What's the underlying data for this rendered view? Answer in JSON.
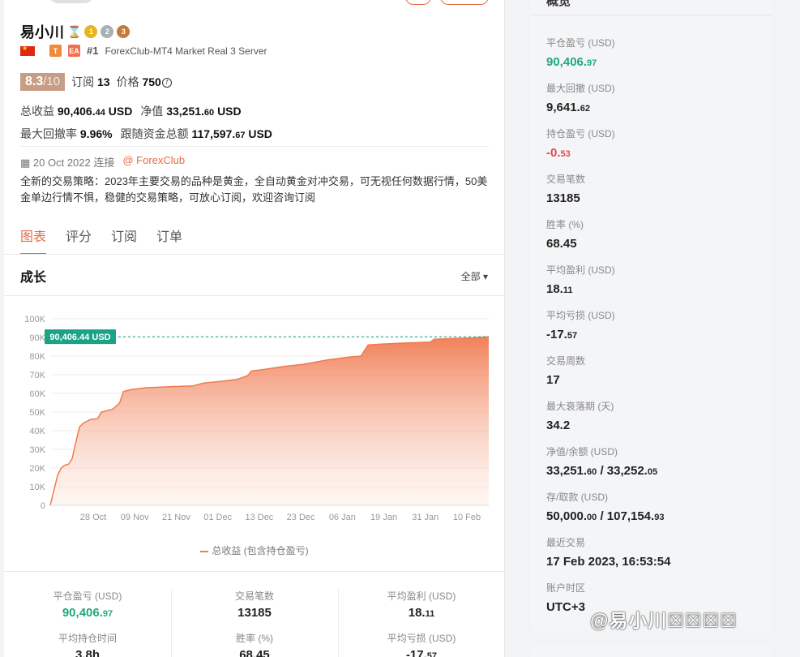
{
  "profile": {
    "name": "易小川",
    "rank": "#1",
    "server": "ForexClub-MT4 Market Real 3 Server",
    "tag_t": "T",
    "tag_ea": "EA",
    "score": "8.3",
    "score_max": "/10",
    "subs_label": "订阅",
    "subs_value": "13",
    "price_label": "价格",
    "price_value": "750",
    "total_profit_label": "总收益",
    "total_profit_int": "90,406.",
    "total_profit_dec": "44",
    "total_profit_unit": "USD",
    "equity_label": "净值",
    "equity_int": "33,251.",
    "equity_dec": "60",
    "equity_unit": "USD",
    "max_dd_label": "最大回撤率",
    "max_dd_value": "9.96%",
    "follow_label": "跟随资金总额",
    "follow_int": "117,597.",
    "follow_dec": "67",
    "follow_unit": "USD",
    "date": "20 Oct 2022 连接",
    "broker": "@ ForexClub",
    "description": "全新的交易策略：2023年主要交易的品种是黄金，全自动黄金对冲交易，可无视任何数据行情，50美金单边行情不惧，稳健的交易策略，可放心订阅，欢迎咨询订阅"
  },
  "tabs": [
    {
      "label": "图表",
      "active": true
    },
    {
      "label": "评分"
    },
    {
      "label": "订阅"
    },
    {
      "label": "订单"
    }
  ],
  "chart_section": {
    "title": "成长",
    "range": "全部 ▾",
    "legend": "总收益 (包含持仓盈亏)"
  },
  "chart_data": {
    "type": "area",
    "title": "",
    "xlabel": "",
    "ylabel": "",
    "ylim": [
      0,
      100000
    ],
    "y_ticks": [
      0,
      10000,
      20000,
      30000,
      40000,
      50000,
      60000,
      70000,
      80000,
      90000,
      100000
    ],
    "y_tick_labels": [
      "0",
      "10K",
      "20K",
      "30K",
      "40K",
      "50K",
      "60K",
      "70K",
      "80K",
      "90K",
      "100K"
    ],
    "x_ticks": [
      "28 Oct",
      "09 Nov",
      "21 Nov",
      "01 Dec",
      "13 Dec",
      "23 Dec",
      "06 Jan",
      "19 Jan",
      "31 Jan",
      "10 Feb"
    ],
    "x_range": [
      "2022-10-20",
      "2023-02-17"
    ],
    "current_label": "90,406.44 USD",
    "current_value": 90406.44,
    "series": [
      {
        "name": "总收益 (包含持仓盈亏)",
        "color": "#f07a50",
        "points": [
          [
            "2022-10-20",
            0
          ],
          [
            "2022-10-21",
            8000
          ],
          [
            "2022-10-22",
            16000
          ],
          [
            "2022-10-23",
            20000
          ],
          [
            "2022-10-24",
            21500
          ],
          [
            "2022-10-25",
            22000
          ],
          [
            "2022-10-26",
            25000
          ],
          [
            "2022-10-27",
            34000
          ],
          [
            "2022-10-28",
            42000
          ],
          [
            "2022-10-29",
            44000
          ],
          [
            "2022-10-31",
            46000
          ],
          [
            "2022-11-02",
            46500
          ],
          [
            "2022-11-03",
            50000
          ],
          [
            "2022-11-04",
            50500
          ],
          [
            "2022-11-06",
            51500
          ],
          [
            "2022-11-07",
            53000
          ],
          [
            "2022-11-08",
            55000
          ],
          [
            "2022-11-09",
            61000
          ],
          [
            "2022-11-11",
            62000
          ],
          [
            "2022-11-15",
            63000
          ],
          [
            "2022-11-21",
            63500
          ],
          [
            "2022-11-28",
            64000
          ],
          [
            "2022-12-01",
            65500
          ],
          [
            "2022-12-06",
            66500
          ],
          [
            "2022-12-10",
            67500
          ],
          [
            "2022-12-13",
            69500
          ],
          [
            "2022-12-14",
            72000
          ],
          [
            "2022-12-18",
            73000
          ],
          [
            "2022-12-23",
            74500
          ],
          [
            "2022-12-28",
            75500
          ],
          [
            "2023-01-04",
            78000
          ],
          [
            "2023-01-10",
            79500
          ],
          [
            "2023-01-13",
            80000
          ],
          [
            "2023-01-15",
            86000
          ],
          [
            "2023-01-19",
            86500
          ],
          [
            "2023-01-25",
            87000
          ],
          [
            "2023-02-01",
            87500
          ],
          [
            "2023-02-02",
            89000
          ],
          [
            "2023-02-08",
            89500
          ],
          [
            "2023-02-13",
            89800
          ],
          [
            "2023-02-17",
            90406.44
          ]
        ]
      }
    ]
  },
  "bottom_stats": [
    {
      "label": "平仓盈亏 (USD)",
      "int": "90,406.",
      "dec": "97",
      "style": "green"
    },
    {
      "label": "交易笔数",
      "int": "13185",
      "dec": ""
    },
    {
      "label": "平均盈利 (USD)",
      "int": "18.",
      "dec": "11"
    },
    {
      "label": "平均持仓时间",
      "int": "3.8h",
      "dec": ""
    },
    {
      "label": "胜率 (%)",
      "int": "68.45",
      "dec": ""
    },
    {
      "label": "平均亏损 (USD)",
      "int": "-17.",
      "dec": "57"
    }
  ],
  "overview": {
    "title": "概览",
    "items": [
      {
        "label": "平仓盈亏 (USD)",
        "int": "90,406.",
        "dec": "97",
        "style": "green"
      },
      {
        "label": "最大回撤 (USD)",
        "int": "9,641.",
        "dec": "62"
      },
      {
        "label": "持仓盈亏 (USD)",
        "int": "-0.",
        "dec": "53",
        "style": "red"
      },
      {
        "label": "交易笔数",
        "int": "13185",
        "dec": ""
      },
      {
        "label": "胜率 (%)",
        "int": "68.45",
        "dec": ""
      },
      {
        "label": "平均盈利 (USD)",
        "int": "18.",
        "dec": "11"
      },
      {
        "label": "平均亏损 (USD)",
        "int": "-17.",
        "dec": "57"
      },
      {
        "label": "交易周数",
        "int": "17",
        "dec": ""
      },
      {
        "label": "最大衰落期 (天)",
        "int": "34.2",
        "dec": ""
      },
      {
        "label": "净值/余额 (USD)",
        "int": "33,251.",
        "dec": "60",
        "int2": " / 33,252.",
        "dec2": "05"
      },
      {
        "label": "存/取款 (USD)",
        "int": "50,000.",
        "dec": "00",
        "int2": " / 107,154.",
        "dec2": "93"
      },
      {
        "label": "最近交易",
        "int": "17 Feb 2023, 16:53:54",
        "dec": ""
      },
      {
        "label": "账户时区",
        "int": "UTC+3",
        "dec": ""
      }
    ]
  },
  "watermark": "@易小川☒☒☒☒",
  "colors": {
    "accent": "#e46b45",
    "green": "#20a87e",
    "red": "#e5484d",
    "chart": "#f07a50"
  }
}
